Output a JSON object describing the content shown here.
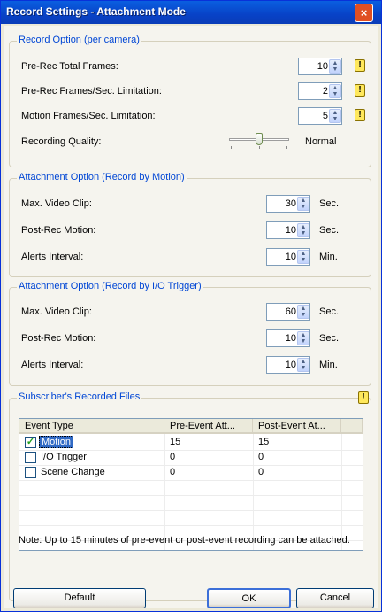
{
  "window": {
    "title": "Record Settings - Attachment Mode",
    "close_glyph": "×"
  },
  "record_option": {
    "title": "Record Option (per camera)",
    "pre_rec_total_frames": {
      "label": "Pre-Rec Total Frames:",
      "value": "10"
    },
    "pre_rec_fps_limit": {
      "label": "Pre-Rec Frames/Sec. Limitation:",
      "value": "2"
    },
    "motion_fps_limit": {
      "label": "Motion Frames/Sec. Limitation:",
      "value": "5"
    },
    "recording_quality": {
      "label": "Recording Quality:",
      "value_text": "Normal",
      "level": 0.5
    }
  },
  "attach_motion": {
    "title": "Attachment Option (Record by Motion)",
    "max_clip": {
      "label": "Max. Video Clip:",
      "value": "30",
      "unit": "Sec."
    },
    "post_rec": {
      "label": "Post-Rec Motion:",
      "value": "10",
      "unit": "Sec."
    },
    "alerts": {
      "label": "Alerts Interval:",
      "value": "10",
      "unit": "Min."
    }
  },
  "attach_io": {
    "title": "Attachment Option (Record by I/O Trigger)",
    "max_clip": {
      "label": "Max. Video Clip:",
      "value": "60",
      "unit": "Sec."
    },
    "post_rec": {
      "label": "Post-Rec Motion:",
      "value": "10",
      "unit": "Sec."
    },
    "alerts": {
      "label": "Alerts Interval:",
      "value": "10",
      "unit": "Min."
    }
  },
  "subscriber": {
    "title": "Subscriber's Recorded Files",
    "columns": [
      "Event Type",
      "Pre-Event Att...",
      "Post-Event At..."
    ],
    "rows": [
      {
        "event": "Motion",
        "checked": true,
        "pre": "15",
        "post": "15"
      },
      {
        "event": "I/O Trigger",
        "checked": false,
        "pre": "0",
        "post": "0"
      },
      {
        "event": "Scene Change",
        "checked": false,
        "pre": "0",
        "post": "0"
      }
    ],
    "note": "Note: Up to 15 minutes of pre-event or post-event recording can be attached."
  },
  "buttons": {
    "default": "Default",
    "ok": "OK",
    "cancel": "Cancel"
  },
  "glyphs": {
    "spin_up": "▲",
    "spin_down": "▼",
    "warning": "!",
    "check": "✓"
  },
  "colors": {
    "title_bar": "#0842c7",
    "group_title": "#0046d5",
    "warning_icon": "#ffe85c",
    "selected_row": "#316ac5"
  }
}
